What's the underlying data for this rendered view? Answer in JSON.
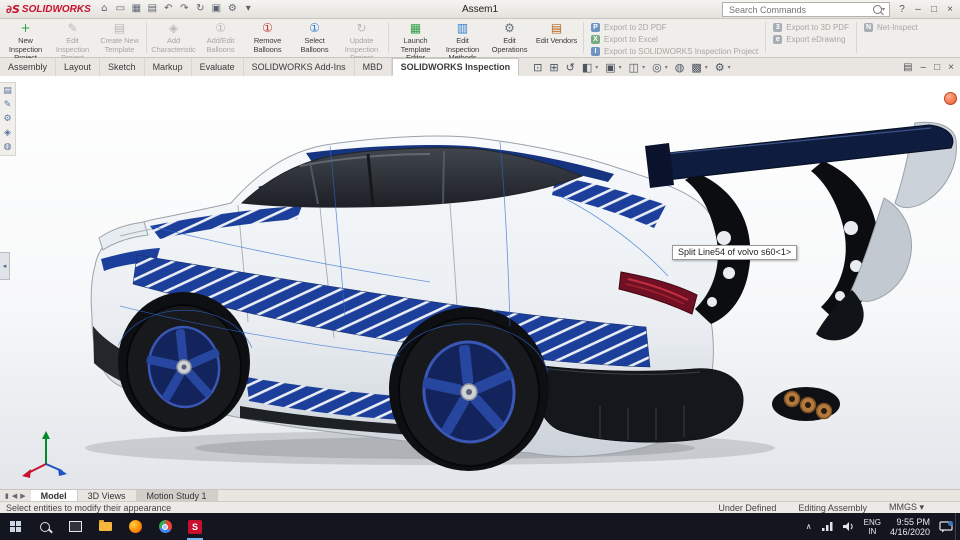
{
  "colors": {
    "accent_blue": "#1d3f9c",
    "sw_red": "#c8102e",
    "taskbar_bg": "#14161f",
    "body_white": "#eef1f4"
  },
  "titlebar": {
    "logo_mark": "∂S",
    "logo_text": "SOLIDWORKS",
    "title": "Assem1",
    "search_placeholder": "Search Commands",
    "qat": [
      {
        "name": "home",
        "glyph": "⌂"
      },
      {
        "name": "open",
        "glyph": "▭"
      },
      {
        "name": "save",
        "glyph": "▦"
      },
      {
        "name": "print",
        "glyph": "▤"
      },
      {
        "name": "undo",
        "glyph": "↶"
      },
      {
        "name": "redo",
        "glyph": "↷"
      },
      {
        "name": "rebuild",
        "glyph": "↻"
      },
      {
        "name": "appearance",
        "glyph": "▣"
      },
      {
        "name": "options",
        "glyph": "⚙"
      },
      {
        "name": "dropdown",
        "glyph": "▾"
      }
    ],
    "controls": {
      "help": "?",
      "minimize": "–",
      "maximize": "□",
      "close": "×"
    }
  },
  "ribbon": {
    "big": [
      {
        "label": "New Inspection Project",
        "glyph": "+",
        "enabled": true
      },
      {
        "label": "Edit Inspection Project",
        "glyph": "✎",
        "enabled": false
      },
      {
        "label": "Create New Template",
        "glyph": "▤",
        "enabled": false
      },
      {
        "label": "Add Characteristic",
        "glyph": "◈",
        "enabled": false
      },
      {
        "label": "Add/Edit Balloons",
        "glyph": "①",
        "enabled": false
      },
      {
        "label": "Remove Balloons",
        "glyph": "①",
        "enabled": true
      },
      {
        "label": "Select Balloons",
        "glyph": "①",
        "enabled": true
      },
      {
        "label": "Update Inspection Project",
        "glyph": "↻",
        "enabled": false
      },
      {
        "label": "Launch Template Editor",
        "glyph": "▦",
        "enabled": true
      },
      {
        "label": "Edit Inspection Methods",
        "glyph": "▥",
        "enabled": true
      },
      {
        "label": "Edit Operations",
        "glyph": "⚙",
        "enabled": true
      },
      {
        "label": "Edit Vendors",
        "glyph": "▤",
        "enabled": true
      }
    ],
    "exports_col1": [
      {
        "label": "Export to 2D PDF",
        "letter": "P"
      },
      {
        "label": "Export to Excel",
        "letter": "X"
      },
      {
        "label": "Export to SOLIDWORKS Inspection Project",
        "letter": "I"
      }
    ],
    "exports_col2": [
      {
        "label": "Export to 3D PDF",
        "letter": "3"
      },
      {
        "label": "Export eDrawing",
        "letter": "e"
      }
    ],
    "net_inspect": {
      "label": "Net-Inspect",
      "letter": "N"
    }
  },
  "tabs": {
    "items": [
      "Assembly",
      "Layout",
      "Sketch",
      "Markup",
      "Evaluate",
      "SOLIDWORKS Add-Ins",
      "MBD",
      "SOLIDWORKS Inspection"
    ],
    "active": "SOLIDWORKS Inspection"
  },
  "headsup": {
    "caret": "▾",
    "icons": [
      {
        "name": "zoom-fit",
        "glyph": "⊡"
      },
      {
        "name": "zoom-area",
        "glyph": "⊞"
      },
      {
        "name": "previous-view",
        "glyph": "↺"
      },
      {
        "name": "section-view",
        "glyph": "◧"
      },
      {
        "name": "view-orientation",
        "glyph": "▣"
      },
      {
        "name": "display-style",
        "glyph": "◫"
      },
      {
        "name": "hide-show-items",
        "glyph": "◎"
      },
      {
        "name": "edit-appearance",
        "glyph": "◍"
      },
      {
        "name": "apply-scene",
        "glyph": "▩"
      },
      {
        "name": "view-settings",
        "glyph": "⚙"
      }
    ]
  },
  "docwin": {
    "pane": "▤",
    "minimize": "–",
    "restore": "□",
    "close": "×"
  },
  "sidebar": {
    "collapse_glyph": "◂",
    "icons": [
      {
        "name": "feature-manager",
        "glyph": "▤"
      },
      {
        "name": "property-manager",
        "glyph": "✎"
      },
      {
        "name": "configuration-manager",
        "glyph": "⚙"
      },
      {
        "name": "dimxpert-manager",
        "glyph": "◈"
      },
      {
        "name": "display-manager",
        "glyph": "◍"
      }
    ]
  },
  "viewport": {
    "tooltip": "Split Line54 of volvo s60<1>"
  },
  "doctabs": {
    "nav": [
      "▮",
      "◀",
      "▶"
    ],
    "items": [
      "Model",
      "3D Views",
      "Motion Study 1"
    ],
    "active": "Model"
  },
  "statusbar": {
    "hint": "Select entities to modify their appearance",
    "definition": "Under Defined",
    "mode": "Editing Assembly",
    "units": "MMGS",
    "units_caret": "▾"
  },
  "taskbar": {
    "sw_badge": "S",
    "tray": {
      "caret": "∧",
      "lang1": "ENG",
      "lang2": "IN",
      "time": "9:55 PM",
      "date": "4/16/2020"
    }
  }
}
